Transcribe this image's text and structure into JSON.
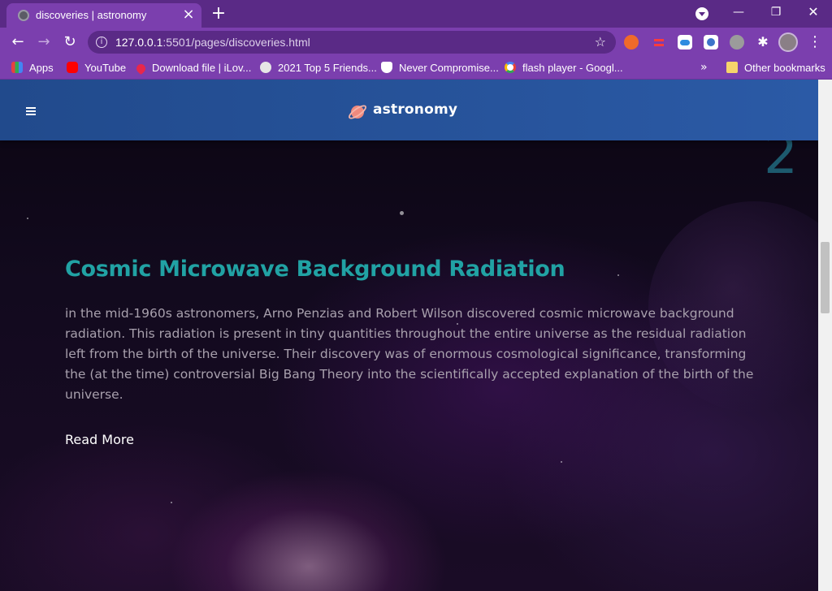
{
  "browser": {
    "tab_title": "discoveries | astronomy",
    "url_host": "127.0.0.1",
    "url_rest": ":5501/pages/discoveries.html"
  },
  "bookmarks": [
    {
      "label": "Apps",
      "icon": "apps-grid-icon"
    },
    {
      "label": "YouTube",
      "icon": "youtube-icon"
    },
    {
      "label": "Download file | iLov...",
      "icon": "heart-icon"
    },
    {
      "label": "2021 Top 5 Friends...",
      "icon": "globe-icon"
    },
    {
      "label": "Never Compromise...",
      "icon": "shield-icon"
    },
    {
      "label": "flash player - Googl...",
      "icon": "google-icon"
    },
    {
      "label": "Other bookmarks",
      "icon": "folder-icon"
    }
  ],
  "site": {
    "logo_text": "astronomy",
    "section_number": "2",
    "headline": "Cosmic Microwave Background Radiation",
    "description": "in the mid-1960s astronomers, Arno Penzias and Robert Wilson discovered cosmic microwave background radiation. This radiation is present in tiny quantities throughout the entire universe as the residual radiation left from the birth of the universe. Their discovery was of enormous cosmological significance, transforming the (at the time) controversial Big Bang Theory into the scientifically accepted explanation of the birth of the universe.",
    "read_more": "Read More"
  },
  "colors": {
    "tabbar": "#5a2a86",
    "toolbar": "#7b3fae",
    "site_nav": "#2b5aa6",
    "headline": "#21a2a4",
    "body_text": "#a8a0ad",
    "section_number": "#1d5a6e"
  }
}
